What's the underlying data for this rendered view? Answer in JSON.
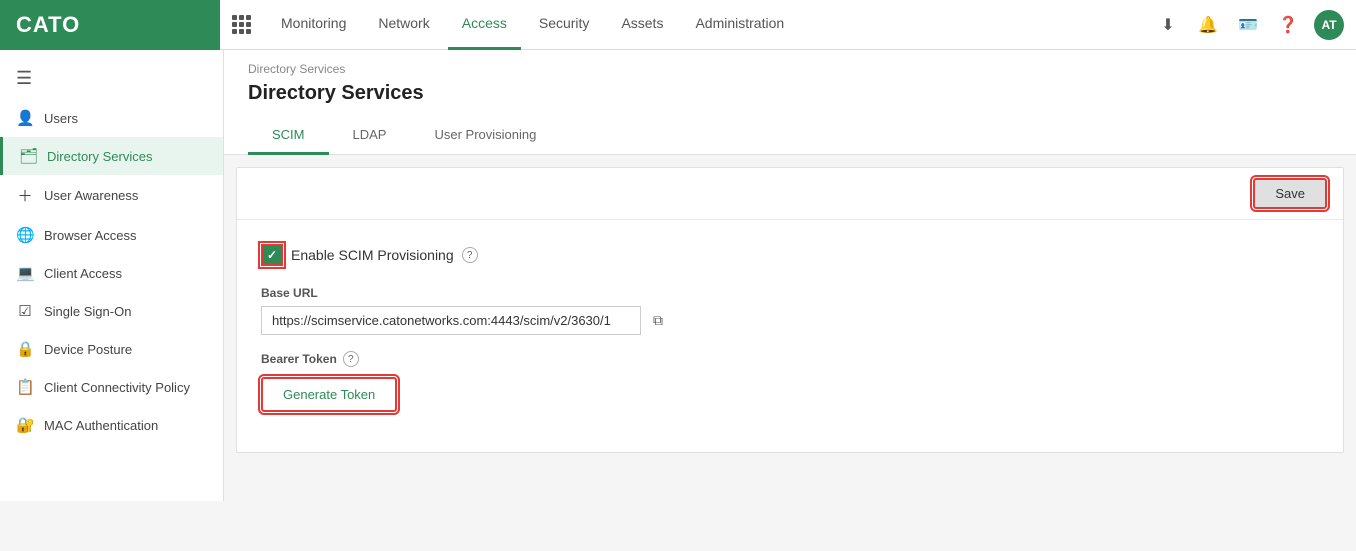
{
  "logo": {
    "text": "CATO"
  },
  "topNav": {
    "items": [
      {
        "label": "Monitoring",
        "active": false
      },
      {
        "label": "Network",
        "active": false
      },
      {
        "label": "Access",
        "active": true
      },
      {
        "label": "Security",
        "active": false
      },
      {
        "label": "Assets",
        "active": false
      },
      {
        "label": "Administration",
        "active": false
      }
    ],
    "avatar": "AT"
  },
  "sidebar": {
    "items": [
      {
        "id": "users",
        "label": "Users",
        "icon": "👤",
        "active": false
      },
      {
        "id": "directory-services",
        "label": "Directory Services",
        "icon": "🗂",
        "active": true
      },
      {
        "id": "user-awareness",
        "label": "User Awareness",
        "icon": "+",
        "active": false
      },
      {
        "id": "browser-access",
        "label": "Browser Access",
        "icon": "🌐",
        "active": false
      },
      {
        "id": "client-access",
        "label": "Client Access",
        "icon": "💻",
        "active": false
      },
      {
        "id": "single-sign-on",
        "label": "Single Sign-On",
        "icon": "☑",
        "active": false
      },
      {
        "id": "device-posture",
        "label": "Device Posture",
        "icon": "🔒",
        "active": false
      },
      {
        "id": "client-connectivity-policy",
        "label": "Client Connectivity Policy",
        "icon": "📋",
        "active": false
      },
      {
        "id": "mac-authentication",
        "label": "MAC Authentication",
        "icon": "🔐",
        "active": false
      }
    ]
  },
  "breadcrumb": "Directory Services",
  "pageTitle": "Directory Services",
  "tabs": [
    {
      "label": "SCIM",
      "active": true
    },
    {
      "label": "LDAP",
      "active": false
    },
    {
      "label": "User Provisioning",
      "active": false
    }
  ],
  "toolbar": {
    "saveLabel": "Save"
  },
  "scim": {
    "enableLabel": "Enable SCIM Provisioning",
    "checked": true,
    "baseUrlLabel": "Base URL",
    "baseUrlValue": "https://scimservice.catonetworks.com:4443/scim/v2/3630/1",
    "bearerTokenLabel": "Bearer Token",
    "generateTokenLabel": "Generate Token"
  }
}
